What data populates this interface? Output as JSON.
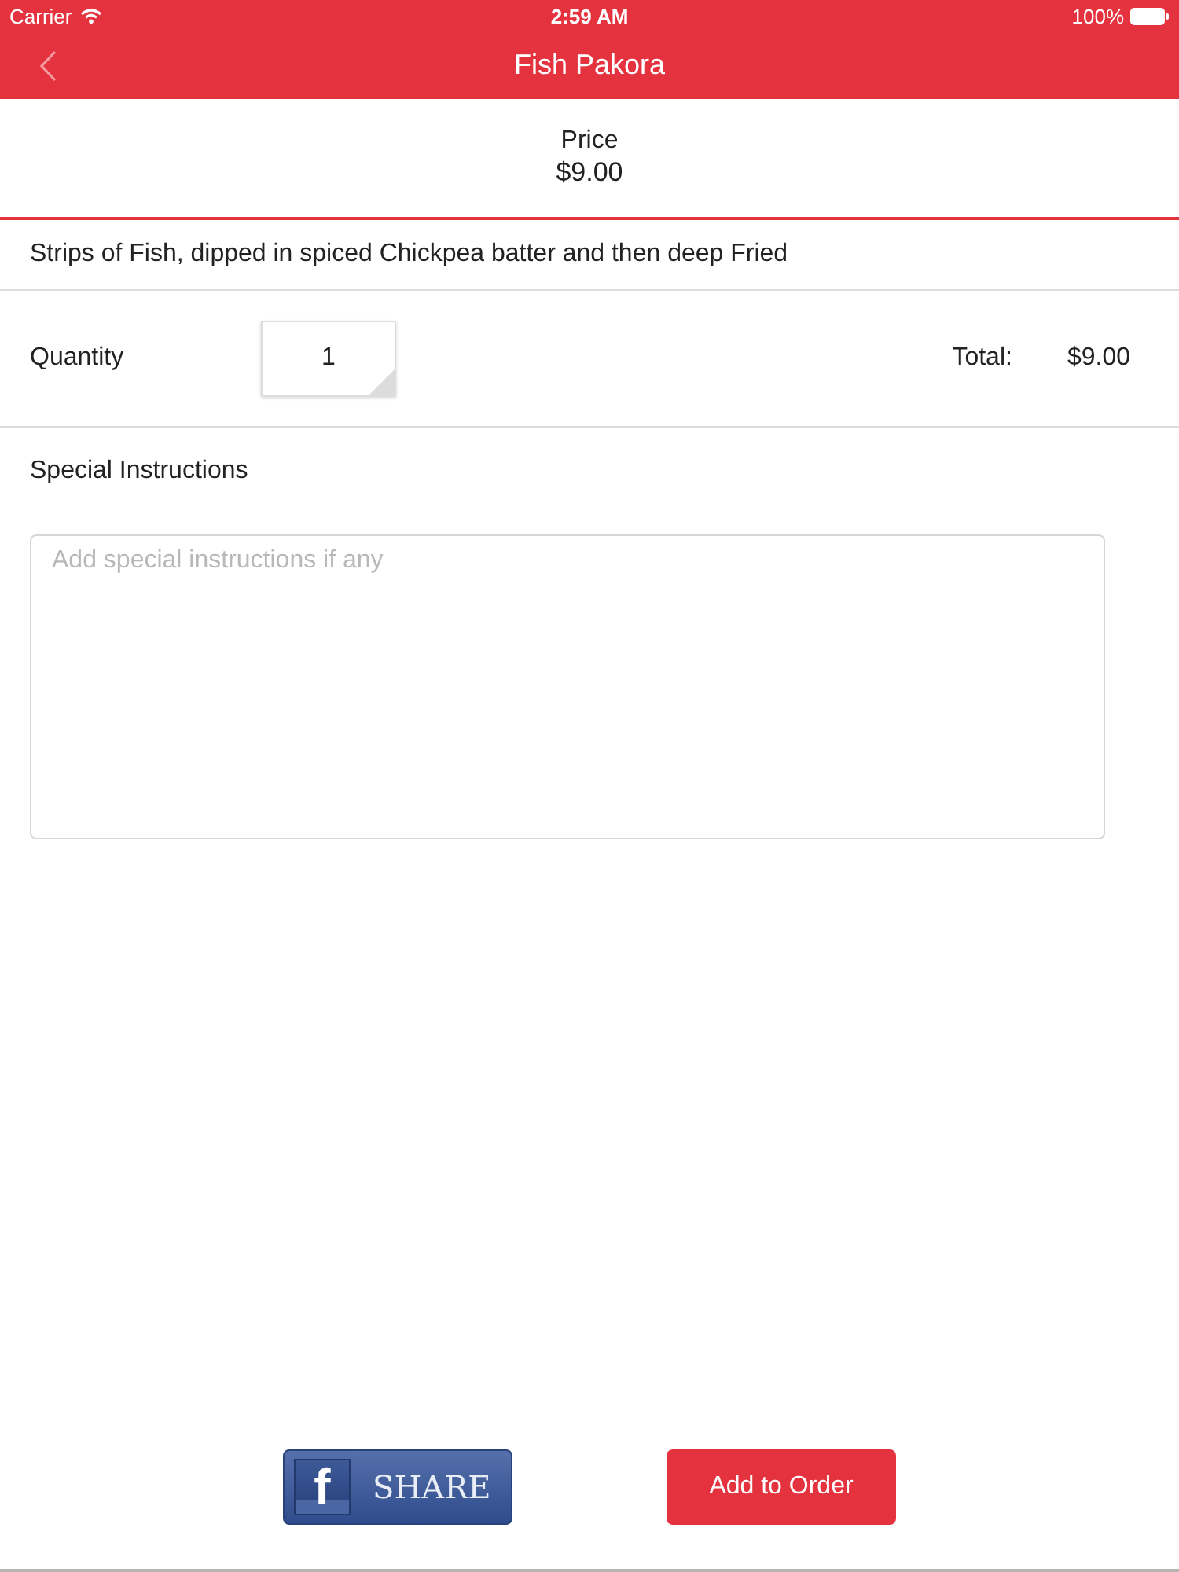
{
  "status_bar": {
    "carrier": "Carrier",
    "time": "2:59 AM",
    "battery": "100%"
  },
  "nav": {
    "title": "Fish Pakora"
  },
  "price": {
    "label": "Price",
    "value": "$9.00"
  },
  "description": "Strips of Fish, dipped in spiced Chickpea batter and then deep Fried",
  "quantity": {
    "label": "Quantity",
    "value": "1",
    "total_label": "Total:",
    "total": "$9.00"
  },
  "instructions": {
    "label": "Special Instructions",
    "placeholder": "Add special instructions if any"
  },
  "actions": {
    "share": {
      "logo": "f",
      "label": "SHARE"
    },
    "add": {
      "label": "Add to Order"
    }
  }
}
